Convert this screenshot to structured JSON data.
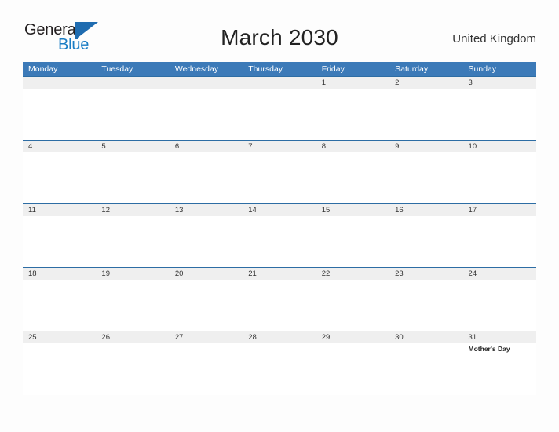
{
  "brand": {
    "name_top": "General",
    "name_bottom": "Blue",
    "mark": "flag-triangle",
    "color_text": "#231f20",
    "color_blue": "#1a7dc4"
  },
  "header": {
    "title": "March 2030",
    "country": "United Kingdom"
  },
  "theme": {
    "header_blue": "#3c7ab8",
    "row_rule_blue": "#2d6da4",
    "date_band_gray": "#efefef",
    "page_background": "#fdfdfd"
  },
  "calendar": {
    "weekdays": [
      "Monday",
      "Tuesday",
      "Wednesday",
      "Thursday",
      "Friday",
      "Saturday",
      "Sunday"
    ],
    "weeks": [
      {
        "days": [
          {
            "date": "",
            "event": ""
          },
          {
            "date": "",
            "event": ""
          },
          {
            "date": "",
            "event": ""
          },
          {
            "date": "",
            "event": ""
          },
          {
            "date": "1",
            "event": ""
          },
          {
            "date": "2",
            "event": ""
          },
          {
            "date": "3",
            "event": ""
          }
        ]
      },
      {
        "days": [
          {
            "date": "4",
            "event": ""
          },
          {
            "date": "5",
            "event": ""
          },
          {
            "date": "6",
            "event": ""
          },
          {
            "date": "7",
            "event": ""
          },
          {
            "date": "8",
            "event": ""
          },
          {
            "date": "9",
            "event": ""
          },
          {
            "date": "10",
            "event": ""
          }
        ]
      },
      {
        "days": [
          {
            "date": "11",
            "event": ""
          },
          {
            "date": "12",
            "event": ""
          },
          {
            "date": "13",
            "event": ""
          },
          {
            "date": "14",
            "event": ""
          },
          {
            "date": "15",
            "event": ""
          },
          {
            "date": "16",
            "event": ""
          },
          {
            "date": "17",
            "event": ""
          }
        ]
      },
      {
        "days": [
          {
            "date": "18",
            "event": ""
          },
          {
            "date": "19",
            "event": ""
          },
          {
            "date": "20",
            "event": ""
          },
          {
            "date": "21",
            "event": ""
          },
          {
            "date": "22",
            "event": ""
          },
          {
            "date": "23",
            "event": ""
          },
          {
            "date": "24",
            "event": ""
          }
        ]
      },
      {
        "days": [
          {
            "date": "25",
            "event": ""
          },
          {
            "date": "26",
            "event": ""
          },
          {
            "date": "27",
            "event": ""
          },
          {
            "date": "28",
            "event": ""
          },
          {
            "date": "29",
            "event": ""
          },
          {
            "date": "30",
            "event": ""
          },
          {
            "date": "31",
            "event": "Mother's Day"
          }
        ]
      }
    ]
  }
}
